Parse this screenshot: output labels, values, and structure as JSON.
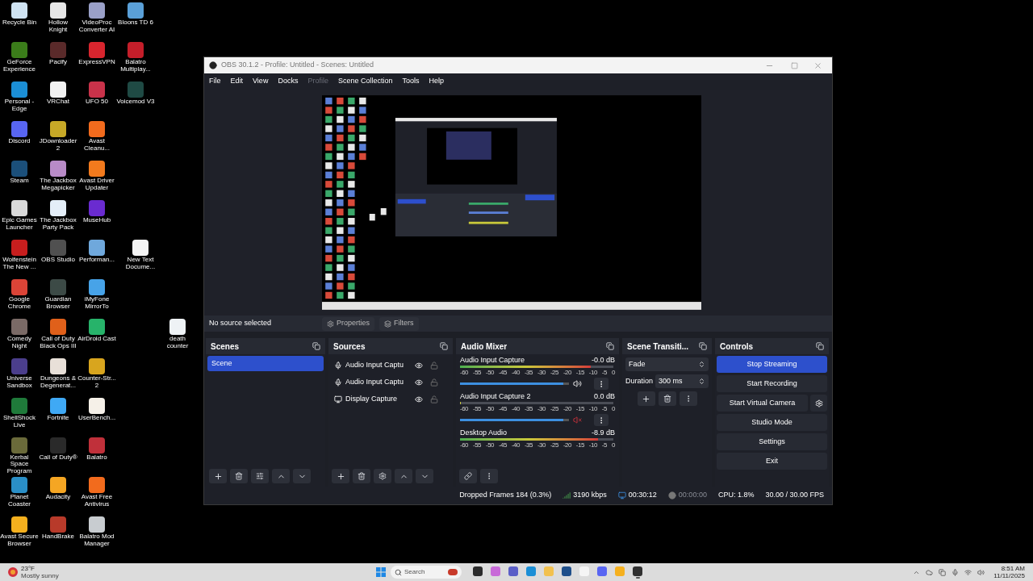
{
  "desktop_icons": [
    [
      {
        "label": "Recycle Bin",
        "color": "#cfe3f2"
      },
      {
        "label": "Hollow Knight",
        "color": "#e6e6e6"
      },
      {
        "label": "VideoProc Converter AI",
        "color": "#9aa0c8"
      },
      {
        "label": "Bloons TD 6",
        "color": "#5aa0d8"
      }
    ],
    [
      {
        "label": "GeForce Experience",
        "color": "#3b7d1a"
      },
      {
        "label": "Pacify",
        "color": "#5a2a2a"
      },
      {
        "label": "ExpressVPN",
        "color": "#d8252e"
      },
      {
        "label": "Balatro Multiplay...",
        "color": "#c41e2a"
      }
    ],
    [
      {
        "label": "Personal - Edge",
        "color": "#1b8fd6"
      },
      {
        "label": "VRChat",
        "color": "#f2f2f2"
      },
      {
        "label": "UFO 50",
        "color": "#c9324a"
      },
      {
        "label": "Voicemod V3",
        "color": "#1f4a44"
      }
    ],
    [
      {
        "label": "Discord",
        "color": "#5865f2"
      },
      {
        "label": "JDownloader 2",
        "color": "#c7a927"
      },
      {
        "label": "Avast Cleanu...",
        "color": "#f26b1d"
      }
    ],
    [
      {
        "label": "Steam",
        "color": "#1b4f7a"
      },
      {
        "label": "The Jackbox Megapicker",
        "color": "#b88bc7"
      },
      {
        "label": "Avast Driver Updater",
        "color": "#f27a1d"
      }
    ],
    [
      {
        "label": "Epic Games Launcher",
        "color": "#d9d9d9"
      },
      {
        "label": "The Jackbox Party Pack",
        "color": "#e4eef8"
      },
      {
        "label": "MuseHub",
        "color": "#6a2bd0"
      }
    ],
    [
      {
        "label": "Wolfenstein The New ...",
        "color": "#c81e1e"
      },
      {
        "label": "OBS Studio",
        "color": "#505050"
      },
      {
        "label": "Performan...",
        "color": "#6fa8dc"
      }
    ],
    [
      {
        "label": "Google Chrome",
        "color": "#db4437"
      },
      {
        "label": "Guardian Browser",
        "color": "#3c4a46"
      },
      {
        "label": "iMyFone MirrorTo",
        "color": "#47a3e8"
      }
    ],
    [
      {
        "label": "Comedy Night",
        "color": "#7a6a66"
      },
      {
        "label": "Call of Duty Black Ops III",
        "color": "#e0601a"
      },
      {
        "label": "AirDroid Cast",
        "color": "#27b36a"
      }
    ],
    [
      {
        "label": "Universe Sandbox",
        "color": "#4b3e8c"
      },
      {
        "label": "Dungeons & Degenerat...",
        "color": "#e8e0d8"
      },
      {
        "label": "Counter-Str... 2",
        "color": "#d8a51e"
      }
    ],
    [
      {
        "label": "ShellShock Live",
        "color": "#1f7a3a"
      },
      {
        "label": "Fortnite",
        "color": "#3fa9f5"
      },
      {
        "label": "UserBench...",
        "color": "#f5f0e8"
      }
    ],
    [
      {
        "label": "Kerbal Space Program",
        "color": "#6a6a3a"
      },
      {
        "label": "Call of Duty®",
        "color": "#2a2a2a"
      },
      {
        "label": "Balatro",
        "color": "#c0303a"
      }
    ],
    [
      {
        "label": "Planet Coaster",
        "color": "#2a8fc7"
      },
      {
        "label": "Audacity",
        "color": "#f5a623"
      },
      {
        "label": "Avast Free Antivirus",
        "color": "#f26b1d"
      }
    ],
    [
      {
        "label": "Avast Secure Browser",
        "color": "#f5b01e"
      },
      {
        "label": "HandBrake",
        "color": "#b83a2a"
      },
      {
        "label": "Balatro Mod Manager",
        "color": "#c8ccd0"
      }
    ]
  ],
  "loose_icons": [
    {
      "label": "New Text Docume...",
      "color": "#f5f5f5"
    },
    {
      "label": "death counter",
      "color": "#eef2f5"
    }
  ],
  "obs": {
    "title": "OBS 30.1.2 - Profile: Untitled - Scenes: Untitled",
    "menu": [
      {
        "label": "File",
        "disabled": false
      },
      {
        "label": "Edit",
        "disabled": false
      },
      {
        "label": "View",
        "disabled": false
      },
      {
        "label": "Docks",
        "disabled": false
      },
      {
        "label": "Profile",
        "disabled": true
      },
      {
        "label": "Scene Collection",
        "disabled": false
      },
      {
        "label": "Tools",
        "disabled": false
      },
      {
        "label": "Help",
        "disabled": false
      }
    ],
    "context": {
      "status": "No source selected",
      "buttons": [
        "Properties",
        "Filters"
      ]
    },
    "scenes": {
      "title": "Scenes",
      "items": [
        {
          "label": "Scene",
          "selected": true
        }
      ]
    },
    "sources": {
      "title": "Sources",
      "items": [
        {
          "label": "Audio Input Captu",
          "kind": "audio",
          "visible": true,
          "locked": false
        },
        {
          "label": "Audio Input Captu",
          "kind": "audio",
          "visible": true,
          "locked": false
        },
        {
          "label": "Display Capture",
          "kind": "display",
          "visible": true,
          "locked": false
        }
      ]
    },
    "mixer": {
      "title": "Audio Mixer",
      "channels": [
        {
          "name": "Audio Input Capture",
          "reading": "-0.0 dB",
          "level": 0.85,
          "ticks": [
            "-60",
            "-55",
            "-50",
            "-45",
            "-40",
            "-35",
            "-30",
            "-25",
            "-20",
            "-15",
            "-10",
            "-5",
            "0"
          ],
          "slider": {
            "level": 0.95,
            "muted": false
          }
        },
        {
          "name": "Audio Input Capture 2",
          "reading": "0.0 dB",
          "level": 0,
          "ticks": [
            "-60",
            "-55",
            "-50",
            "-45",
            "-40",
            "-35",
            "-30",
            "-25",
            "-20",
            "-15",
            "-10",
            "-5",
            "0"
          ],
          "slider": {
            "level": 0.95,
            "muted": true
          }
        },
        {
          "name": "Desktop Audio",
          "reading": "-8.9 dB",
          "level": 0.9,
          "ticks": [
            "-60",
            "-55",
            "-50",
            "-45",
            "-40",
            "-35",
            "-30",
            "-25",
            "-20",
            "-15",
            "-10",
            "-5",
            "0"
          ]
        }
      ]
    },
    "transitions": {
      "title": "Scene Transiti...",
      "type": "Fade",
      "duration_label": "Duration",
      "duration": "300 ms"
    },
    "controls": {
      "title": "Controls",
      "buttons": [
        {
          "label": "Stop Streaming",
          "active": true,
          "gear": false
        },
        {
          "label": "Start Recording",
          "active": false,
          "gear": false
        },
        {
          "label": "Start Virtual Camera",
          "active": false,
          "gear": true
        },
        {
          "label": "Studio Mode",
          "active": false,
          "gear": false
        },
        {
          "label": "Settings",
          "active": false,
          "gear": false
        },
        {
          "label": "Exit",
          "active": false,
          "gear": false
        }
      ]
    },
    "status": {
      "dropped": "Dropped Frames 184 (0.3%)",
      "bitrate": "3190 kbps",
      "stream_time": "00:30:12",
      "record_time": "00:00:00",
      "cpu": "CPU: 1.8%",
      "fps": "30.00 / 30.00 FPS"
    }
  },
  "taskbar": {
    "weather": {
      "temp": "23°F",
      "condition": "Mostly sunny"
    },
    "search": "Search",
    "apps": [
      {
        "color": "#2b2b2b",
        "running": false
      },
      {
        "color": "#c86ad8",
        "running": false
      },
      {
        "color": "#5b5fc7",
        "running": false
      },
      {
        "color": "#1b8fd6",
        "running": false
      },
      {
        "color": "#f2c14e",
        "running": false
      },
      {
        "color": "#1f4f8a",
        "running": false
      },
      {
        "color": "#f5f5f5",
        "running": false
      },
      {
        "color": "#5865f2",
        "running": false
      },
      {
        "color": "#f5b01e",
        "running": false
      },
      {
        "color": "#303030",
        "running": true
      }
    ],
    "time": "8:51 AM",
    "date": "11/11/2025"
  }
}
